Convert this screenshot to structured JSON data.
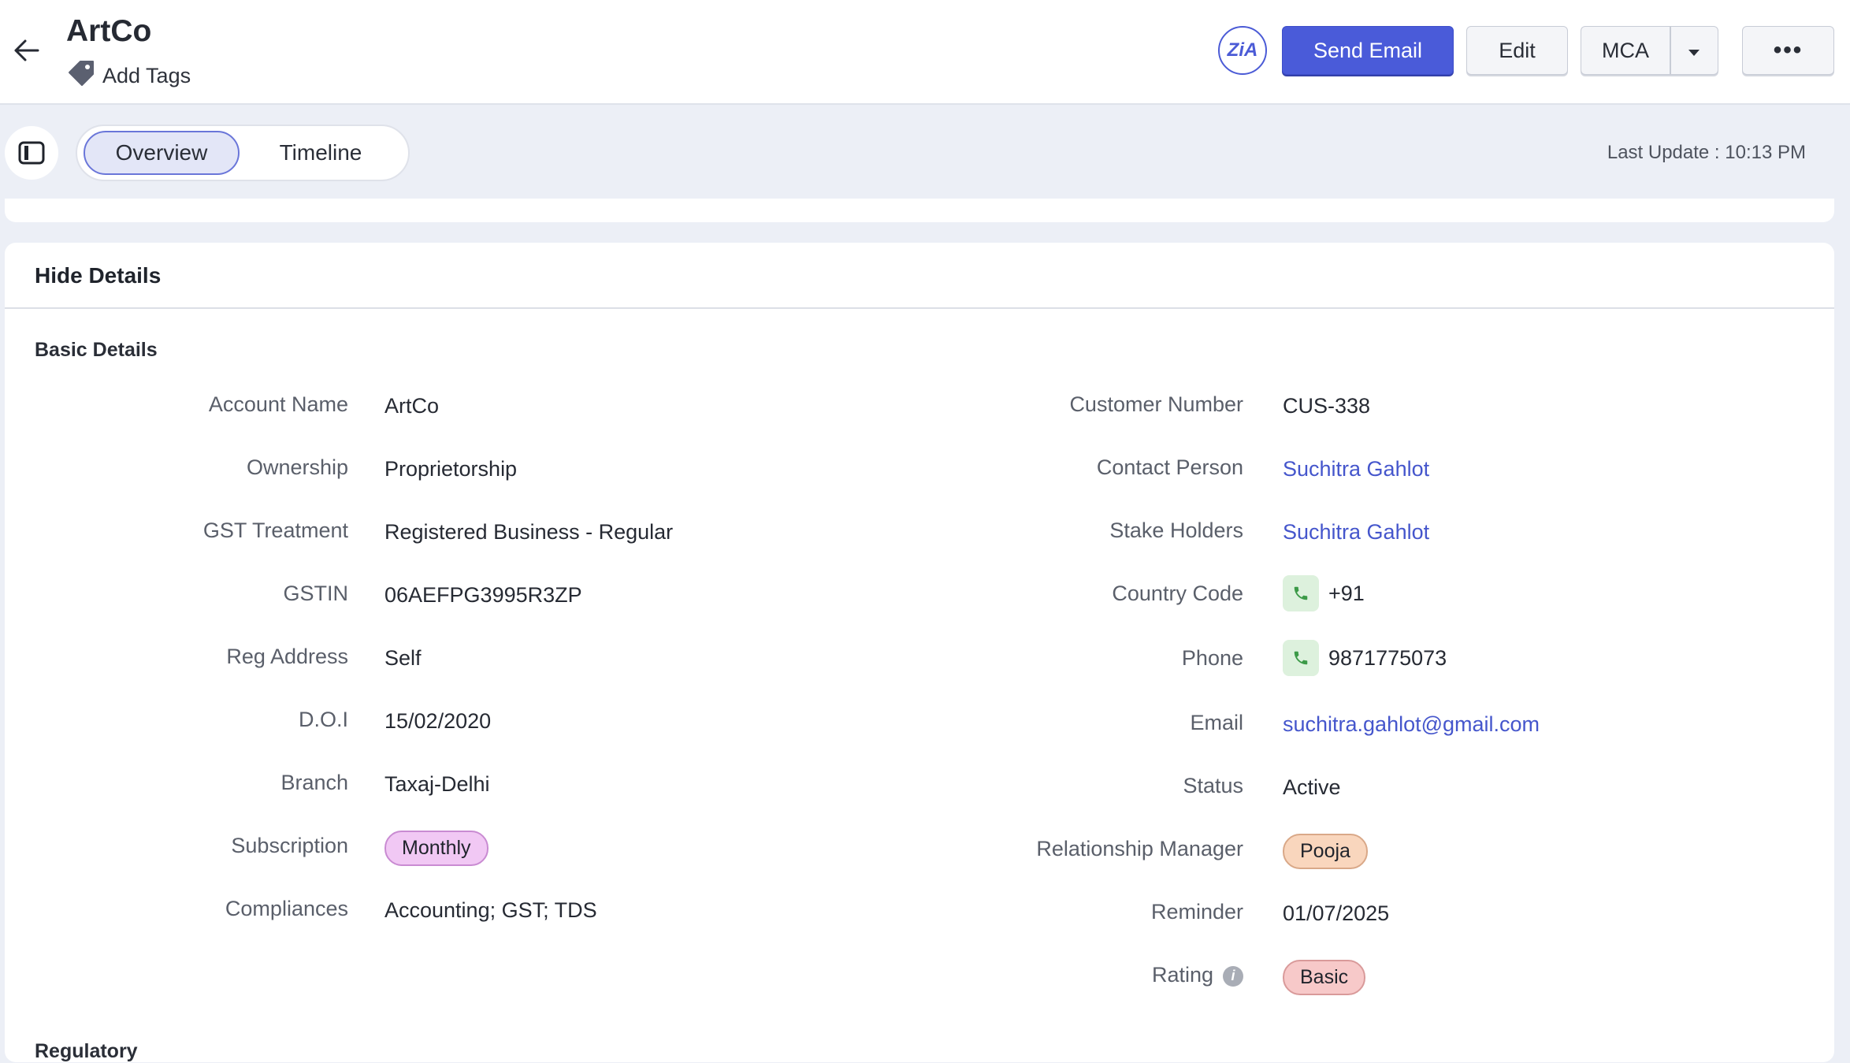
{
  "header": {
    "title": "ArtCo",
    "add_tags_label": "Add Tags",
    "zia_label": "ZiA",
    "send_email_label": "Send Email",
    "edit_label": "Edit",
    "mca_label": "MCA",
    "more_label": "•••"
  },
  "tabs": [
    {
      "label": "Overview",
      "active": true
    },
    {
      "label": "Timeline",
      "active": false
    }
  ],
  "last_update": "Last Update : 10:13 PM",
  "details": {
    "hide_label": "Hide Details",
    "section_title": "Basic Details",
    "next_section_title": "Regulatory",
    "left": [
      {
        "label": "Account Name",
        "value": "ArtCo"
      },
      {
        "label": "Ownership",
        "value": "Proprietorship"
      },
      {
        "label": "GST Treatment",
        "value": "Registered Business - Regular"
      },
      {
        "label": "GSTIN",
        "value": "06AEFPG3995R3ZP"
      },
      {
        "label": "Reg Address",
        "value": "Self"
      },
      {
        "label": "D.O.I",
        "value": "15/02/2020"
      },
      {
        "label": "Branch",
        "value": "Taxaj-Delhi"
      },
      {
        "label": "Subscription",
        "value": "Monthly"
      },
      {
        "label": "Compliances",
        "value": "Accounting; GST; TDS"
      }
    ],
    "right": [
      {
        "label": "Customer Number",
        "value": "CUS-338"
      },
      {
        "label": "Contact Person",
        "value": "Suchitra Gahlot"
      },
      {
        "label": "Stake Holders",
        "value": "Suchitra Gahlot"
      },
      {
        "label": "Country Code",
        "value": "+91"
      },
      {
        "label": "Phone",
        "value": "9871775073"
      },
      {
        "label": "Email",
        "value": "suchitra.gahlot@gmail.com"
      },
      {
        "label": "Status",
        "value": "Active"
      },
      {
        "label": "Relationship Manager",
        "value": "Pooja"
      },
      {
        "label": "Reminder",
        "value": "01/07/2025"
      },
      {
        "label": "Rating",
        "value": "Basic"
      }
    ]
  },
  "colors": {
    "accent": "#4a5bd9",
    "link": "#4556cc",
    "monthly_pill": "#f1c8f4",
    "pooja_pill": "#f9d6bd",
    "basic_pill": "#f7c9c9",
    "phone_icon_bg": "#ddf1dd"
  },
  "icons": [
    "back-arrow-icon",
    "tag-icon",
    "zia-icon",
    "chevron-down-icon",
    "sidebar-toggle-icon",
    "phone-icon",
    "info-icon"
  ]
}
